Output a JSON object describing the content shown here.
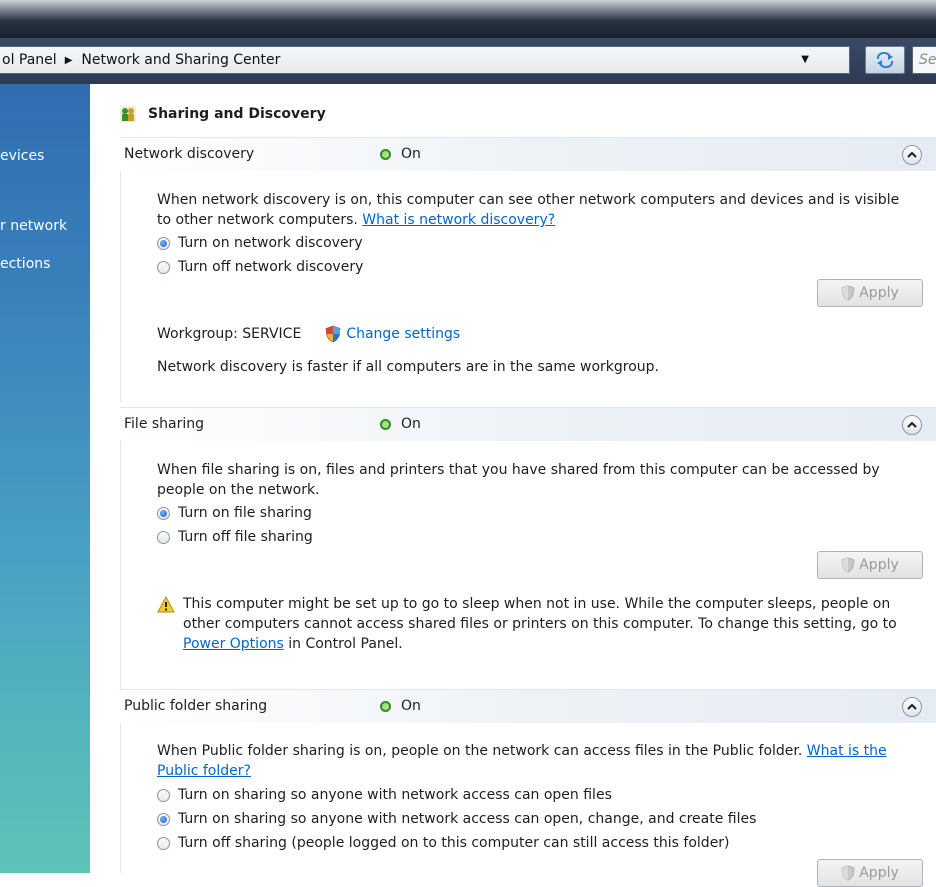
{
  "address_bar": {
    "breadcrumb": [
      "ol Panel",
      "Network and Sharing Center"
    ],
    "search_placeholder": "Se"
  },
  "sidebar": {
    "items": [
      "evices",
      "r network",
      "ections"
    ]
  },
  "panel": {
    "title": "Sharing and Discovery",
    "sections": {
      "network_discovery": {
        "name": "Network discovery",
        "status": "On",
        "description": "When network discovery is on, this computer can see other network computers and devices and is visible to other network computers.",
        "help_link": "What is network discovery?",
        "options": [
          "Turn on network discovery",
          "Turn off network discovery"
        ],
        "selected_option": "Turn on network discovery",
        "apply_label": "Apply",
        "workgroup_label": "Workgroup: SERVICE",
        "change_settings_label": "Change settings",
        "note": "Network discovery is faster if all computers are in the same workgroup."
      },
      "file_sharing": {
        "name": "File sharing",
        "status": "On",
        "description": "When file sharing is on, files and printers that you have shared from this computer can be accessed by people on the network.",
        "options": [
          "Turn on file sharing",
          "Turn off file sharing"
        ],
        "selected_option": "Turn on file sharing",
        "apply_label": "Apply",
        "warning_text_before": "This computer might be set up to go to sleep when not in use. While the computer sleeps, people on other computers cannot access shared files or printers on this computer. To change this setting, go to",
        "warning_link": "Power Options",
        "warning_text_after": "in Control Panel."
      },
      "public_folder_sharing": {
        "name": "Public folder sharing",
        "status": "On",
        "description": "When Public folder sharing is on, people on the network can access files in the Public folder.",
        "help_link": "What is the Public folder?",
        "options": [
          "Turn on sharing so anyone with network access can open files",
          "Turn on sharing so anyone with network access can open, change, and create files",
          "Turn off sharing (people logged on to this computer can still access this folder)"
        ],
        "selected_option": "Turn on sharing so anyone with network access can open, change, and create files",
        "apply_label": "Apply"
      }
    }
  },
  "colors": {
    "link": "#0066cc",
    "status_on": "#2e8b2e",
    "sidebar_top": "#2f6db0",
    "sidebar_bottom": "#5fc2b7"
  },
  "icons": {
    "panel_title": "sharing-users-icon",
    "status": "status-on-dot-icon",
    "collapse": "chevron-up-icon",
    "apply": "uac-shield-icon",
    "warning": "warning-triangle-icon",
    "refresh": "refresh-arrows-icon"
  }
}
